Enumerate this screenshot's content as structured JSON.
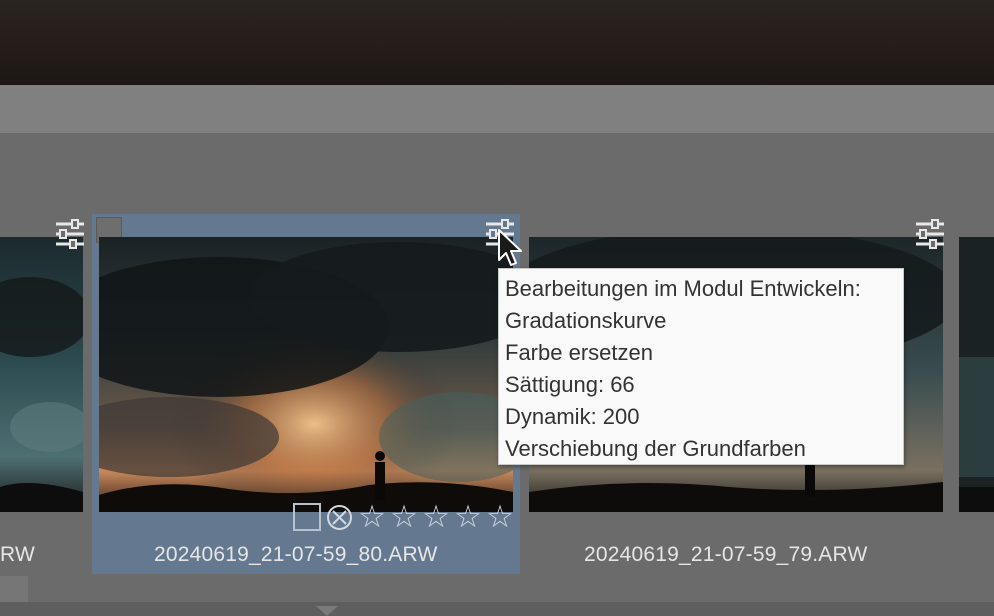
{
  "filmstrip": {
    "thumbnails": [
      {
        "filename": "20240619_21-07-59_80.ARW",
        "selected": false,
        "partial_filename": "RW"
      },
      {
        "filename": "20240619_21-07-59_80.ARW",
        "selected": true
      },
      {
        "filename": "20240619_21-07-59_79.ARW",
        "selected": false
      }
    ]
  },
  "selected_thumb": {
    "filename": "20240619_21-07-59_80.ARW",
    "rating": {
      "stars_total": 5,
      "stars_filled": 0,
      "star_glyph": "☆"
    }
  },
  "left_partial": {
    "filename_fragment": "RW"
  },
  "right_thumb": {
    "filename": "20240619_21-07-59_79.ARW"
  },
  "tooltip": {
    "title": "Bearbeitungen im Modul Entwickeln:",
    "lines": [
      "Gradationskurve",
      "Farbe ersetzen",
      "Sättigung: 66",
      "Dynamik: 200",
      "Verschiebung der Grundfarben"
    ]
  },
  "colors": {
    "selection": "#64788f",
    "filmstrip_bg": "#6b6b6b",
    "tooltip_bg": "#f9f9f9"
  },
  "icons": {
    "adjust": "sliders-icon",
    "flag": "pick-flag-icon",
    "reject": "reject-icon",
    "star": "star-outline-icon",
    "cursor": "mouse-pointer-icon"
  }
}
